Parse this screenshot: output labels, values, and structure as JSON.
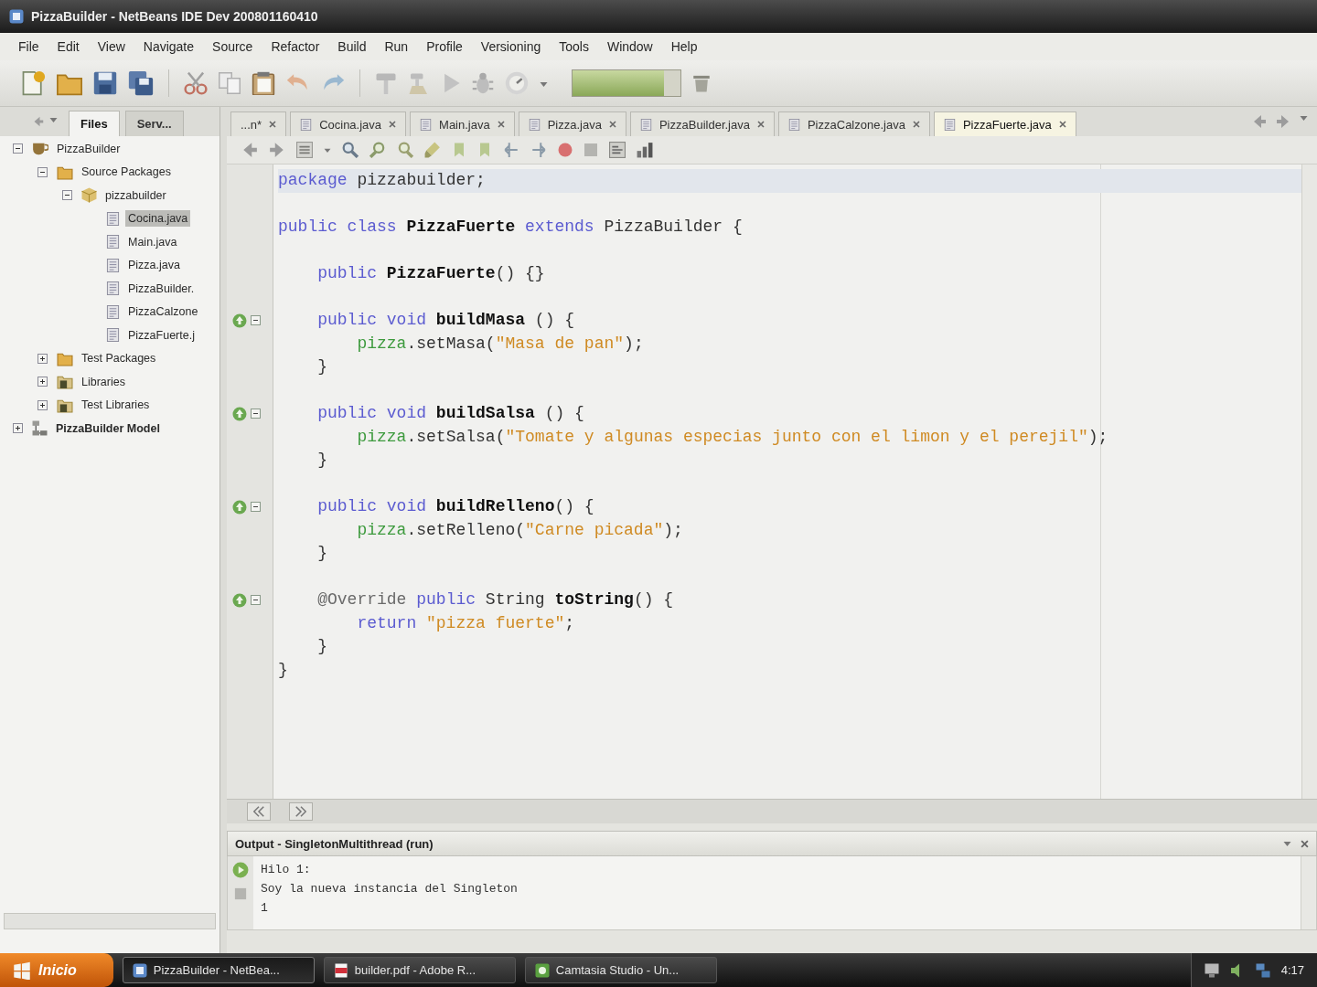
{
  "window": {
    "title": "PizzaBuilder - NetBeans IDE Dev 200801160410"
  },
  "menu": [
    "File",
    "Edit",
    "View",
    "Navigate",
    "Source",
    "Refactor",
    "Build",
    "Run",
    "Profile",
    "Versioning",
    "Tools",
    "Window",
    "Help"
  ],
  "toolbar": {
    "memory": {
      "level": 0.85
    }
  },
  "side_tabs": [
    {
      "label": "Files",
      "selected": true
    },
    {
      "label": "Serv...",
      "selected": false
    }
  ],
  "project_tree": [
    {
      "label": "PizzaBuilder",
      "kind": "project",
      "expanded": true,
      "selected": false,
      "children": [
        {
          "label": "Source Packages",
          "kind": "source_folder",
          "expanded": true,
          "selected": false,
          "children": [
            {
              "label": "pizzabuilder",
              "kind": "package",
              "expanded": true,
              "selected": false,
              "children": [
                {
                  "label": "Cocina.java",
                  "kind": "java_file",
                  "selected": true
                },
                {
                  "label": "Main.java",
                  "kind": "java_file",
                  "selected": false
                },
                {
                  "label": "Pizza.java",
                  "kind": "java_file",
                  "selected": false
                },
                {
                  "label": "PizzaBuilder.",
                  "kind": "java_file",
                  "selected": false
                },
                {
                  "label": "PizzaCalzone",
                  "kind": "java_file",
                  "selected": false
                },
                {
                  "label": "PizzaFuerte.j",
                  "kind": "java_file",
                  "selected": false
                }
              ]
            }
          ]
        },
        {
          "label": "Test Packages",
          "kind": "source_folder",
          "expanded": false,
          "selected": false
        },
        {
          "label": "Libraries",
          "kind": "library",
          "expanded": false,
          "selected": false
        },
        {
          "label": "Test Libraries",
          "kind": "library",
          "expanded": false,
          "selected": false
        }
      ]
    },
    {
      "label": "PizzaBuilder Model",
      "kind": "main_project",
      "expanded": false,
      "selected": false
    }
  ],
  "editor_tabs": [
    {
      "label": "...n*",
      "selected": false
    },
    {
      "label": "Cocina.java",
      "selected": false
    },
    {
      "label": "Main.java",
      "selected": false
    },
    {
      "label": "Pizza.java",
      "selected": false
    },
    {
      "label": "PizzaBuilder.java",
      "selected": false
    },
    {
      "label": "PizzaCalzone.java",
      "selected": false
    },
    {
      "label": "PizzaFuerte.java",
      "selected": true
    }
  ],
  "code_blocks": [
    {
      "lines": [
        {
          "kind": "plain",
          "current": true,
          "segments": [
            {
              "kind": "keyword",
              "text": "package"
            },
            {
              "kind": "plain",
              "text": " pizzabuilder;"
            }
          ]
        }
      ]
    },
    {
      "lines": [
        {
          "kind": "plain",
          "current": false,
          "segments": [
            {
              "kind": "keyword",
              "text": "public class"
            },
            {
              "kind": "name",
              "text": " PizzaFuerte"
            },
            {
              "kind": "keyword",
              "text": " extends"
            },
            {
              "kind": "plain",
              "text": " PizzaBuilder {"
            }
          ]
        }
      ]
    },
    {
      "lines": [
        {
          "kind": "plain",
          "current": false,
          "segments": [
            {
              "kind": "keyword",
              "text": "    public"
            },
            {
              "kind": "name",
              "text": " PizzaFuerte"
            },
            {
              "kind": "plain",
              "text": "() {}"
            }
          ]
        }
      ]
    },
    {
      "lines": [
        {
          "kind": "override",
          "current": false,
          "segments": [
            {
              "kind": "keyword",
              "text": "    public void"
            },
            {
              "kind": "name",
              "text": " buildMasa"
            },
            {
              "kind": "plain",
              "text": " () {"
            }
          ]
        },
        {
          "kind": "plain",
          "current": false,
          "segments": [
            {
              "kind": "field",
              "text": "        pizza"
            },
            {
              "kind": "plain",
              "text": ".setMasa("
            },
            {
              "kind": "string",
              "text": "\"Masa de pan\""
            },
            {
              "kind": "plain",
              "text": ");"
            }
          ]
        },
        {
          "kind": "plain",
          "current": false,
          "segments": [
            {
              "kind": "plain",
              "text": "    }"
            }
          ]
        }
      ]
    },
    {
      "lines": [
        {
          "kind": "override",
          "current": false,
          "segments": [
            {
              "kind": "keyword",
              "text": "    public void"
            },
            {
              "kind": "name",
              "text": " buildSalsa"
            },
            {
              "kind": "plain",
              "text": " () {"
            }
          ]
        },
        {
          "kind": "plain",
          "current": false,
          "segments": [
            {
              "kind": "field",
              "text": "        pizza"
            },
            {
              "kind": "plain",
              "text": ".setSalsa("
            },
            {
              "kind": "string",
              "text": "\"Tomate y algunas especias junto con el limon y el perejil\""
            },
            {
              "kind": "plain",
              "text": ");"
            }
          ]
        },
        {
          "kind": "plain",
          "current": false,
          "segments": [
            {
              "kind": "plain",
              "text": "    }"
            }
          ]
        }
      ]
    },
    {
      "lines": [
        {
          "kind": "override",
          "current": false,
          "segments": [
            {
              "kind": "keyword",
              "text": "    public void"
            },
            {
              "kind": "name",
              "text": " buildRelleno"
            },
            {
              "kind": "plain",
              "text": "() {"
            }
          ]
        },
        {
          "kind": "plain",
          "current": false,
          "segments": [
            {
              "kind": "field",
              "text": "        pizza"
            },
            {
              "kind": "plain",
              "text": ".setRelleno("
            },
            {
              "kind": "string",
              "text": "\"Carne picada\""
            },
            {
              "kind": "plain",
              "text": ");"
            }
          ]
        },
        {
          "kind": "plain",
          "current": false,
          "segments": [
            {
              "kind": "plain",
              "text": "    }"
            }
          ]
        }
      ]
    },
    {
      "lines": [
        {
          "kind": "override",
          "current": false,
          "segments": [
            {
              "kind": "annotation",
              "text": "    @Override"
            },
            {
              "kind": "keyword",
              "text": " public"
            },
            {
              "kind": "plain",
              "text": " String"
            },
            {
              "kind": "name",
              "text": " toString"
            },
            {
              "kind": "plain",
              "text": "() {"
            }
          ]
        },
        {
          "kind": "plain",
          "current": false,
          "segments": [
            {
              "kind": "keyword",
              "text": "        return"
            },
            {
              "kind": "string",
              "text": " \"pizza fuerte\""
            },
            {
              "kind": "plain",
              "text": ";"
            }
          ]
        },
        {
          "kind": "plain",
          "current": false,
          "segments": [
            {
              "kind": "plain",
              "text": "    }"
            }
          ]
        },
        {
          "kind": "plain",
          "current": false,
          "segments": [
            {
              "kind": "plain",
              "text": "}"
            }
          ]
        }
      ]
    }
  ],
  "output": {
    "title": "Output - SingletonMultithread (run)",
    "lines": [
      "Hilo 1:",
      "Soy la nueva instancia del Singleton",
      "1"
    ]
  },
  "taskbar": {
    "start": "Inicio",
    "windows": [
      {
        "label": "PizzaBuilder - NetBea...",
        "kind": "ide",
        "selected": true
      },
      {
        "label": "builder.pdf - Adobe R...",
        "kind": "pdf",
        "selected": false
      },
      {
        "label": "Camtasia Studio - Un...",
        "kind": "recorder",
        "selected": false
      }
    ],
    "clock": "4:17"
  }
}
